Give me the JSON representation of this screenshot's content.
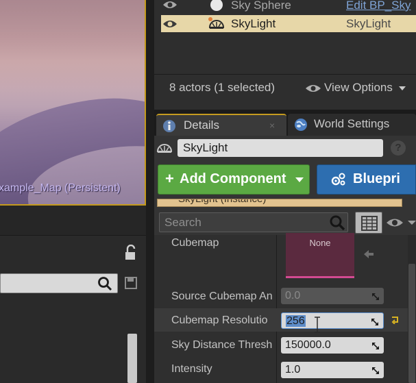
{
  "viewport": {
    "map_label": "xample_Map (Persistent)"
  },
  "outliner": {
    "rows": [
      {
        "name": "Sky Sphere",
        "type": "Edit BP_Sky"
      },
      {
        "name": "SkyLight",
        "type": "SkyLight"
      }
    ],
    "actor_count": "8 actors (1 selected)",
    "view_options": "View Options"
  },
  "tabs": [
    {
      "label": "Details",
      "close": "×"
    },
    {
      "label": "World Settings"
    }
  ],
  "details": {
    "actor_name": "SkyLight",
    "help": "?",
    "add_component": {
      "plus": "+",
      "label": "Add Component"
    },
    "blueprint_label": "Bluepri",
    "component_strip": "SkyLight (Instance)",
    "search_placeholder": "Search"
  },
  "properties": {
    "cubemap": {
      "label": "Cubemap",
      "value": "None"
    },
    "source_cubemap_angle": {
      "label": "Source Cubemap An",
      "value": "0.0"
    },
    "cubemap_resolution": {
      "label": "Cubemap Resolutio",
      "value": "256"
    },
    "sky_distance_threshold": {
      "label": "Sky Distance Thresh",
      "value": "150000.0"
    },
    "intensity": {
      "label": "Intensity",
      "value": "1.0"
    }
  },
  "colors": {
    "accent_gold": "#c59b1f",
    "add_component_green": "#5ba943",
    "blueprint_blue": "#2d6eb0",
    "selection_row": "#e7d7a8",
    "cubemap_swatch": "#5b2a3f"
  },
  "icons": [
    "eye-icon",
    "sphere-icon",
    "skylight-icon",
    "info-icon",
    "globe-icon",
    "search-icon",
    "grid-icon",
    "lock-icon",
    "save-icon",
    "drag-icon",
    "reset-icon"
  ]
}
